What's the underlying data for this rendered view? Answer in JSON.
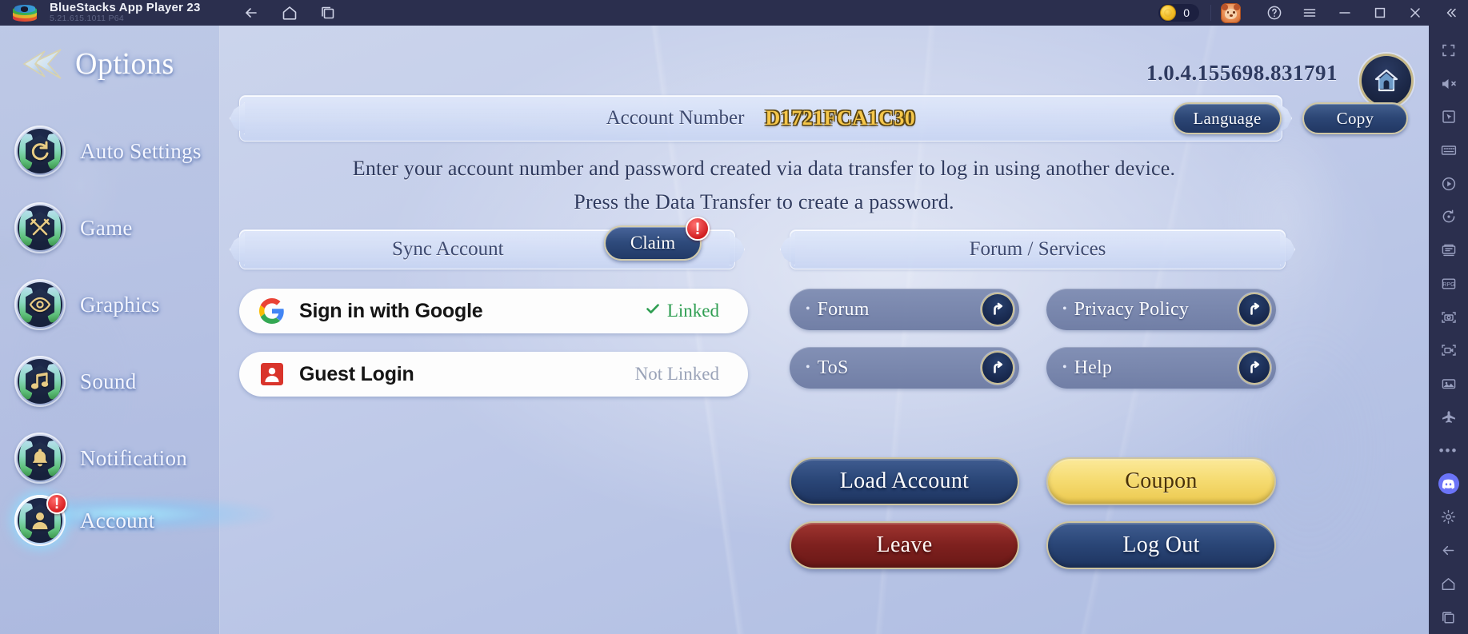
{
  "titlebar": {
    "app_name": "BlueStacks App Player 23",
    "app_version": "5.21.615.1011  P64",
    "logo_icon": "bluestacks-logo-icon",
    "nav": [
      {
        "name": "back-icon",
        "label": "Back"
      },
      {
        "name": "home-icon",
        "label": "Home"
      },
      {
        "name": "recent-apps-icon",
        "label": "Recent Apps"
      }
    ],
    "coin_count": "0",
    "coin_icon": "coin-icon",
    "pet_icon": "pet-avatar-icon",
    "help_icon": "help-circle-icon",
    "menu_icon": "hamburger-menu-icon",
    "minimize_icon": "minimize-icon",
    "maximize_icon": "maximize-icon",
    "close_icon": "close-icon",
    "collapse_icon": "chevron-double-left-icon"
  },
  "sidebar": {
    "title": "Options",
    "title_icon": "options-arrow-icon",
    "items": [
      {
        "label": "Auto Settings",
        "icon": "auto-settings-badge-icon",
        "active": false,
        "alert": false
      },
      {
        "label": "Game",
        "icon": "crossed-swords-badge-icon",
        "active": false,
        "alert": false
      },
      {
        "label": "Graphics",
        "icon": "eye-badge-icon",
        "active": false,
        "alert": false
      },
      {
        "label": "Sound",
        "icon": "music-note-badge-icon",
        "active": false,
        "alert": false
      },
      {
        "label": "Notification",
        "icon": "bell-badge-icon",
        "active": false,
        "alert": false
      },
      {
        "label": "Account",
        "icon": "person-badge-icon",
        "active": true,
        "alert": true,
        "alert_text": "!"
      }
    ]
  },
  "main": {
    "version": "1.0.4.155698.831791",
    "home_button_icon": "house-icon",
    "account": {
      "label": "Account Number",
      "number": "D1721FCA1C30",
      "language_button": "Language",
      "copy_button": "Copy"
    },
    "instructions": [
      "Enter your account number and password created via data transfer to log in using another device.",
      "Press the Data Transfer to create a password."
    ],
    "sync": {
      "title": "Sync Account",
      "claim_button": "Claim",
      "claim_alert": "!",
      "rows": [
        {
          "name": "Sign in with Google",
          "icon": "google-logo-icon",
          "status": "Linked",
          "linked": true,
          "check_icon": "check-icon"
        },
        {
          "name": "Guest Login",
          "icon": "guest-avatar-icon",
          "status": "Not Linked",
          "linked": false
        }
      ]
    },
    "forum": {
      "title": "Forum / Services",
      "bullet": "•",
      "link_icon": "external-link-arrow-icon",
      "items": [
        {
          "label": "Forum"
        },
        {
          "label": "ToS"
        },
        {
          "label": "Privacy Policy"
        },
        {
          "label": "Help"
        }
      ]
    },
    "actions": [
      {
        "label": "Load Account",
        "style": "blue"
      },
      {
        "label": "Coupon",
        "style": "gold"
      },
      {
        "label": "Leave",
        "style": "red"
      },
      {
        "label": "Log Out",
        "style": "blue"
      }
    ]
  },
  "rail": {
    "items": [
      {
        "name": "fullscreen-icon"
      },
      {
        "name": "mute-volume-icon"
      },
      {
        "name": "cursor-pointer-icon"
      },
      {
        "name": "keyboard-controls-icon"
      },
      {
        "name": "macro-play-icon"
      },
      {
        "name": "rotate-screen-icon"
      },
      {
        "name": "multi-instance-icon"
      },
      {
        "name": "rpg-mode-icon"
      },
      {
        "name": "screenshot-camera-icon"
      },
      {
        "name": "record-video-icon"
      },
      {
        "name": "media-gallery-icon"
      },
      {
        "name": "eco-mode-airplane-icon"
      },
      {
        "name": "more-options-icon"
      },
      {
        "name": "discord-icon"
      },
      {
        "name": "settings-gear-icon"
      },
      {
        "name": "back-arrow-icon"
      },
      {
        "name": "home-icon"
      },
      {
        "name": "recent-apps-icon"
      }
    ]
  },
  "colors": {
    "titlebar_bg": "#2b2f4e",
    "accent_gold": "#f5c64a",
    "linked_green": "#2f9e52",
    "alert_red": "#d01d1f",
    "blue_button": "#2c4675",
    "red_button": "#7f211f",
    "discord_purple": "#6b74f8"
  }
}
